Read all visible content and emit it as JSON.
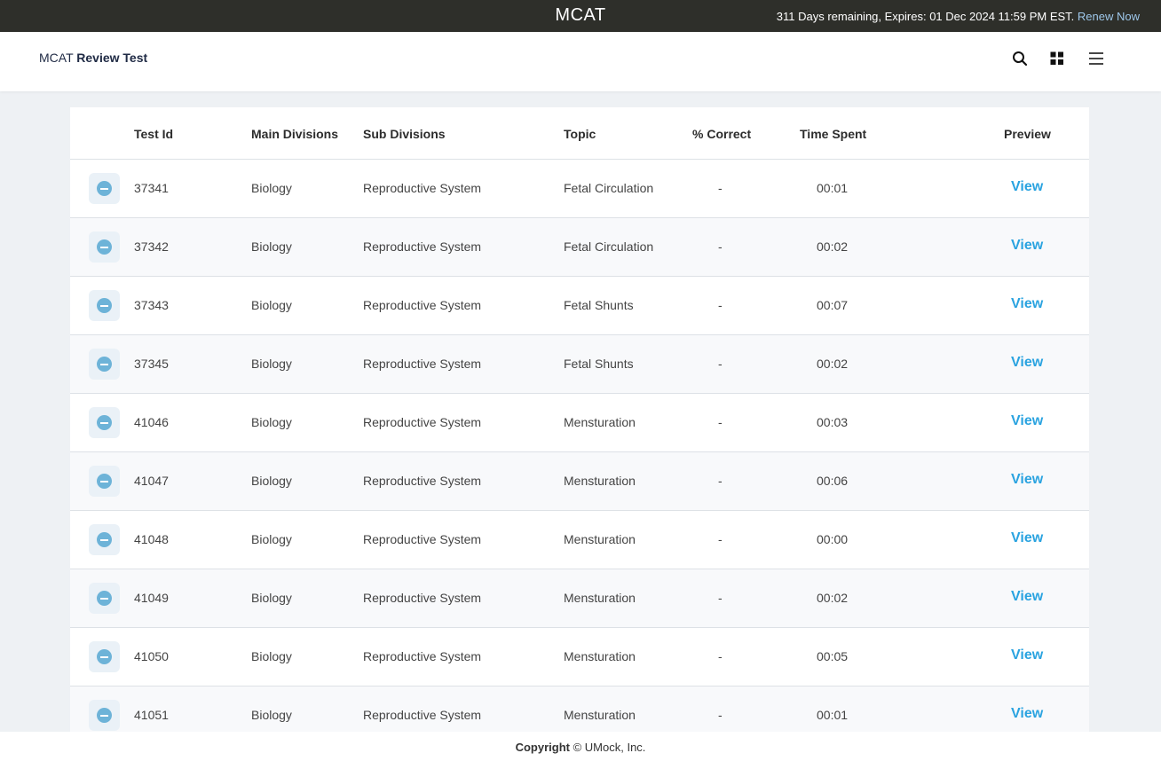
{
  "topbar": {
    "title": "MCAT",
    "expiry": "311 Days remaining, Expires: 01 Dec 2024 11:59 PM EST.",
    "renew_label": "Renew Now"
  },
  "header": {
    "brand_prefix": "MCAT",
    "brand_suffix": "Review Test",
    "icons": [
      "search-icon",
      "grid-icon",
      "menu-icon"
    ]
  },
  "table": {
    "columns": [
      "Test Id",
      "Main Divisions",
      "Sub Divisions",
      "Topic",
      "% Correct",
      "Time Spent",
      "Preview"
    ],
    "rows": [
      {
        "id": "37341",
        "main": "Biology",
        "sub": "Reproductive System",
        "topic": "Fetal Circulation",
        "correct": "-",
        "time": "00:01",
        "preview": "View"
      },
      {
        "id": "37342",
        "main": "Biology",
        "sub": "Reproductive System",
        "topic": "Fetal Circulation",
        "correct": "-",
        "time": "00:02",
        "preview": "View"
      },
      {
        "id": "37343",
        "main": "Biology",
        "sub": "Reproductive System",
        "topic": "Fetal Shunts",
        "correct": "-",
        "time": "00:07",
        "preview": "View"
      },
      {
        "id": "37345",
        "main": "Biology",
        "sub": "Reproductive System",
        "topic": "Fetal Shunts",
        "correct": "-",
        "time": "00:02",
        "preview": "View"
      },
      {
        "id": "41046",
        "main": "Biology",
        "sub": "Reproductive System",
        "topic": "Mensturation",
        "correct": "-",
        "time": "00:03",
        "preview": "View"
      },
      {
        "id": "41047",
        "main": "Biology",
        "sub": "Reproductive System",
        "topic": "Mensturation",
        "correct": "-",
        "time": "00:06",
        "preview": "View"
      },
      {
        "id": "41048",
        "main": "Biology",
        "sub": "Reproductive System",
        "topic": "Mensturation",
        "correct": "-",
        "time": "00:00",
        "preview": "View"
      },
      {
        "id": "41049",
        "main": "Biology",
        "sub": "Reproductive System",
        "topic": "Mensturation",
        "correct": "-",
        "time": "00:02",
        "preview": "View"
      },
      {
        "id": "41050",
        "main": "Biology",
        "sub": "Reproductive System",
        "topic": "Mensturation",
        "correct": "-",
        "time": "00:05",
        "preview": "View"
      },
      {
        "id": "41051",
        "main": "Biology",
        "sub": "Reproductive System",
        "topic": "Mensturation",
        "correct": "-",
        "time": "00:01",
        "preview": "View"
      }
    ]
  },
  "footer": {
    "copyright_label": "Copyright",
    "copyright_text": "© UMock, Inc."
  },
  "colors": {
    "topbar_bg": "#2e2f2a",
    "link": "#2aa3e0",
    "renew": "#9ec7ea",
    "toggle_dot": "#6db3d8"
  }
}
